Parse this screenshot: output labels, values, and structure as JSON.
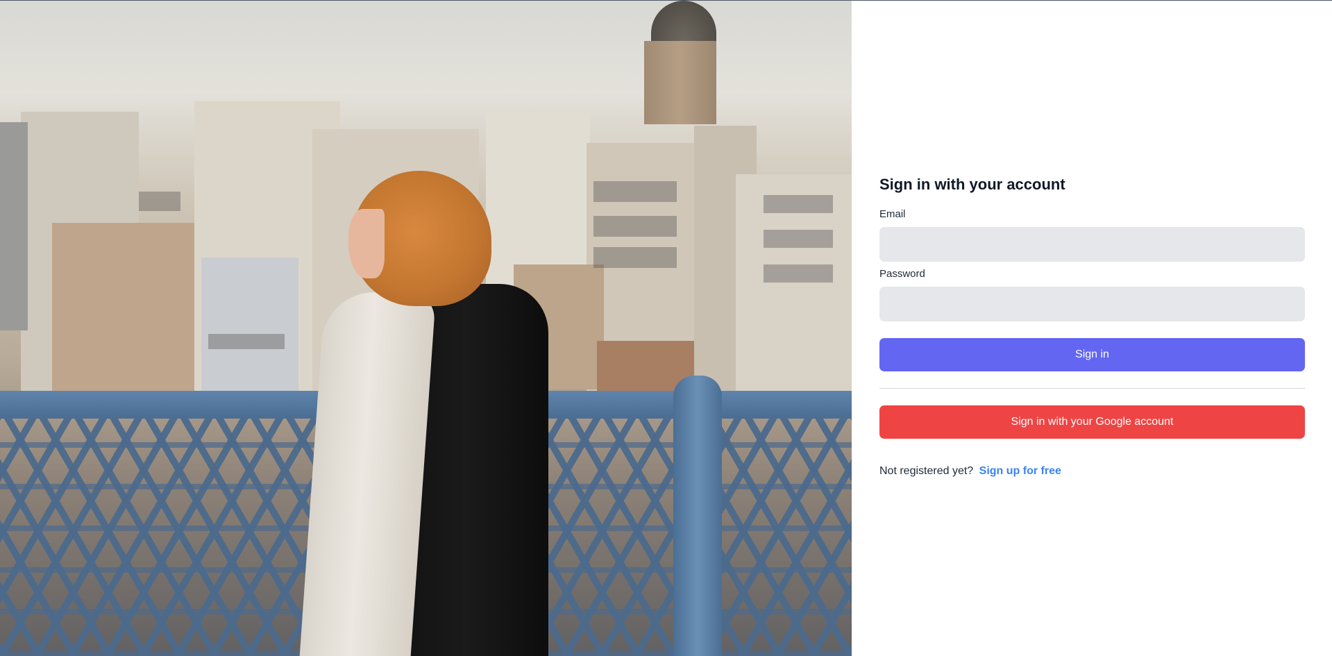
{
  "photo": {
    "description_icon": "city-bridge-photo"
  },
  "login": {
    "title": "Sign in with your account",
    "email_label": "Email",
    "email_value": "",
    "password_label": "Password",
    "password_value": "",
    "sign_in_button": "Sign in",
    "google_button": "Sign in with your Google account",
    "register_prompt": "Not registered yet?",
    "register_link": "Sign up for free"
  },
  "colors": {
    "primary": "#6366f1",
    "google": "#ef4444",
    "link": "#3b82f6",
    "input_bg": "#e5e7eb"
  }
}
